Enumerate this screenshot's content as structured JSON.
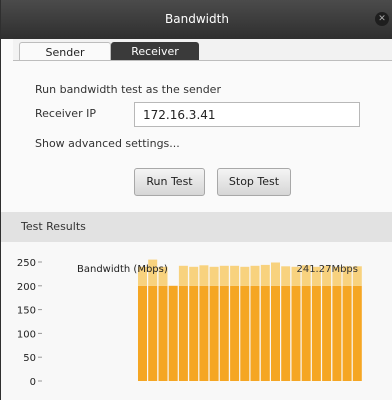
{
  "window": {
    "title": "Bandwidth",
    "close_glyph": "✕"
  },
  "tabs": [
    {
      "label": "Sender",
      "active": true
    },
    {
      "label": "Receiver",
      "active": false
    }
  ],
  "sender": {
    "description": "Run bandwidth test as the sender",
    "receiver_ip_label": "Receiver IP",
    "receiver_ip_value": "172.16.3.41",
    "advanced_link": "Show advanced settings...",
    "run_test_label": "Run Test",
    "stop_test_label": "Stop Test"
  },
  "results": {
    "header": "Test Results"
  },
  "colors": {
    "bar": "#f5a623",
    "bar_highlight": "#f8d27e",
    "titlebar": "#3a3a3a"
  },
  "chart_data": {
    "type": "bar",
    "title": "Bandwidth (Mbps)",
    "current_value_label": "241.27Mbps",
    "ylim": [
      0,
      250
    ],
    "yticks": [
      0,
      50,
      100,
      150,
      200,
      250
    ],
    "values": [
      240,
      255,
      240,
      200,
      242,
      240,
      243,
      240,
      242,
      242,
      240,
      242,
      244,
      249,
      241,
      240,
      243,
      240,
      242,
      240,
      241,
      241
    ]
  }
}
